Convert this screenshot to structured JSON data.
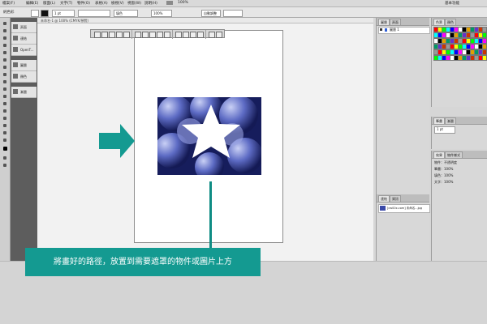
{
  "menubar": {
    "items": [
      "檔案(F)",
      "編輯(E)",
      "版面(L)",
      "文字(T)",
      "物件(O)",
      "表格(A)",
      "檢視(V)",
      "視窗(W)",
      "說明(H)"
    ],
    "zoom": "100%",
    "workspace": "基本功能"
  },
  "controlbar": {
    "label_left": "純色彩",
    "stroke_weight": "1 pt",
    "fill_label": "填色",
    "percent": "100%",
    "auto_fit": "自動調整"
  },
  "document_tab": "未命名-1 @ 100% (CMYK/預覽)",
  "dock_items": [
    "頁面",
    "連結",
    "OpenT...",
    "圖層",
    "顏色",
    "漸層"
  ],
  "floatbar": {
    "title": "Control"
  },
  "right_panels": {
    "layers_tabs": [
      "圖層",
      "頁面"
    ],
    "layers_row": "圖層 1",
    "links_tabs": [
      "連結",
      "資訊"
    ],
    "links_row": "[cw00x.com] 未命名...jpg",
    "swatches_tabs": [
      "色票",
      "顏色"
    ],
    "stroke_tabs": [
      "筆畫",
      "漸層"
    ],
    "stroke_weight": "1 pt",
    "effects_tabs": [
      "效果",
      "物件樣式"
    ],
    "effects_rows": [
      "物件：不透明度",
      "筆畫：100%",
      "填色：100%",
      "文字：100%"
    ]
  },
  "annotation": {
    "text": "將畫好的路徑，放置到需要遮罩的物件或圖片上方",
    "accent": "#149a91"
  }
}
